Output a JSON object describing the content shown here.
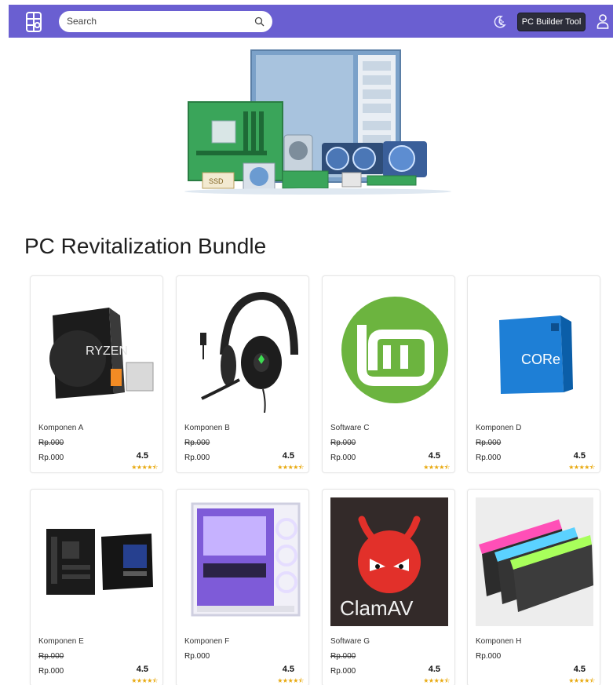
{
  "header": {
    "search_placeholder": "Search",
    "builder_label": "PC Builder Tool",
    "accent": "#6a5fd1"
  },
  "section": {
    "title": "PC Revitalization Bundle"
  },
  "products": [
    {
      "name": "Komponen A",
      "old_price": "Rp.000",
      "price": "Rp.000",
      "rating": "4.5",
      "stars": "★★★★⯪",
      "icon": "amd-ryzen-5-box-image"
    },
    {
      "name": "Komponen B",
      "old_price": "Rp.000",
      "price": "Rp.000",
      "rating": "4.5",
      "stars": "★★★★⯪",
      "icon": "gaming-headset-image"
    },
    {
      "name": "Software C",
      "old_price": "Rp.000",
      "price": "Rp.000",
      "rating": "4.5",
      "stars": "★★★★⯪",
      "icon": "linux-mint-logo-image"
    },
    {
      "name": "Komponen D",
      "old_price": "Rp.000",
      "price": "Rp.000",
      "rating": "4.5",
      "stars": "★★★★⯪",
      "icon": "intel-core-i5-box-image"
    },
    {
      "name": "Komponen E",
      "old_price": "Rp.000",
      "price": "Rp.000",
      "rating": "4.5",
      "stars": "★★★★⯪",
      "icon": "asus-motherboard-image"
    },
    {
      "name": "Komponen F",
      "old_price": "",
      "price": "Rp.000",
      "rating": "4.5",
      "stars": "★★★★⯪",
      "icon": "white-pc-case-image"
    },
    {
      "name": "Software G",
      "old_price": "Rp.000",
      "price": "Rp.000",
      "rating": "4.5",
      "stars": "★★★★⯪",
      "icon": "clamav-logo-image"
    },
    {
      "name": "Komponen H",
      "old_price": "",
      "price": "Rp.000",
      "rating": "4.5",
      "stars": "★★★★⯪",
      "icon": "rgb-ram-sticks-image"
    }
  ],
  "products_title_text": {
    "clamav_text": "ClamAV",
    "ryzen_text": "RYZEN",
    "core_text": "CORe"
  }
}
